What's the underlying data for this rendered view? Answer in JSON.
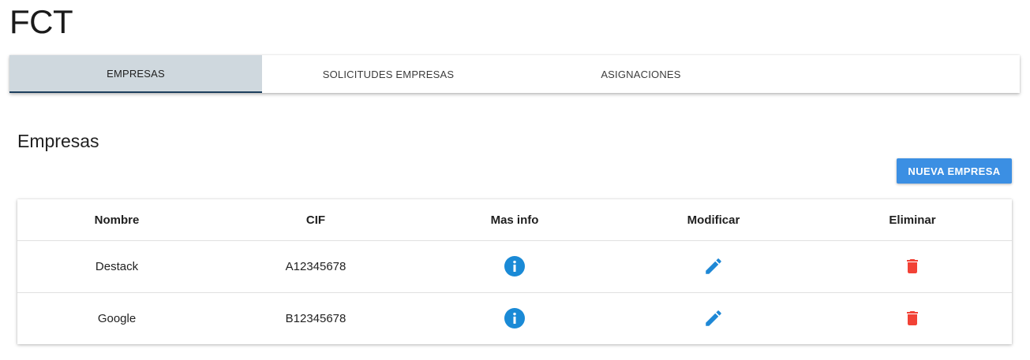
{
  "app": {
    "title": "FCT"
  },
  "tabs": [
    {
      "label": "EMPRESAS",
      "active": true
    },
    {
      "label": "SOLICITUDES EMPRESAS",
      "active": false
    },
    {
      "label": "ASIGNACIONES",
      "active": false
    }
  ],
  "section": {
    "title": "Empresas",
    "new_button_label": "NUEVA EMPRESA"
  },
  "table": {
    "headers": {
      "nombre": "Nombre",
      "cif": "CIF",
      "info": "Mas info",
      "modify": "Modificar",
      "delete": "Eliminar"
    },
    "rows": [
      {
        "nombre": "Destack",
        "cif": "A12345678"
      },
      {
        "nombre": "Google",
        "cif": "B12345678"
      }
    ]
  },
  "icons": {
    "info": "info-circle-icon",
    "edit": "pencil-icon",
    "delete": "trash-icon"
  },
  "colors": {
    "accent": "#3b8fe3",
    "active_tab_bg": "#cfd8de",
    "active_tab_indicator": "#1d3f5e",
    "info_icon": "#1a8ad6",
    "edit_icon": "#1e88d6",
    "delete_icon": "#f24236"
  }
}
